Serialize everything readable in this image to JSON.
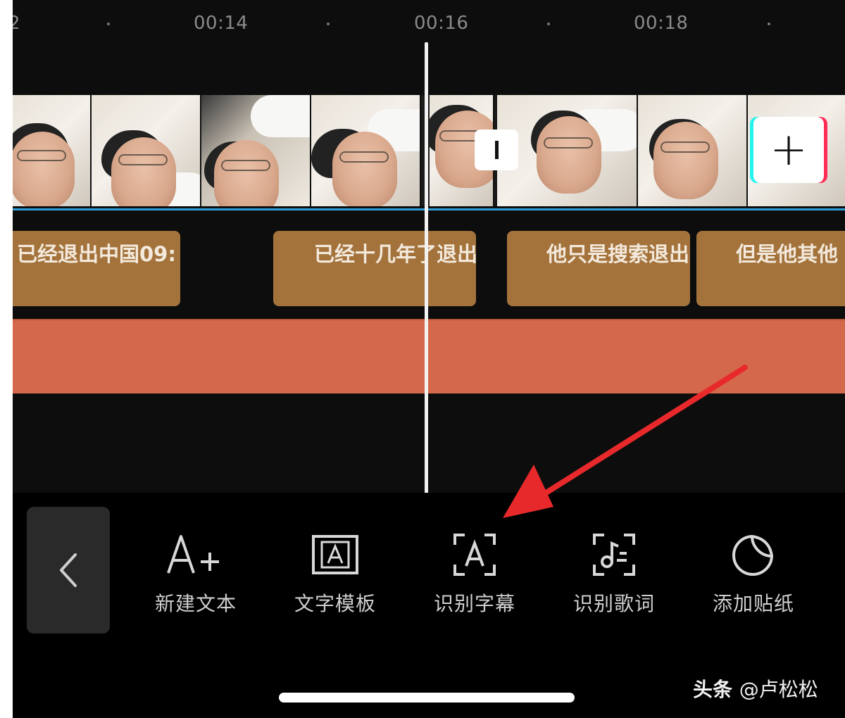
{
  "ruler": {
    "edge_label": "2",
    "labels": [
      "00:14",
      "00:16",
      "00:18"
    ]
  },
  "transition_icon": "transition-bar-icon",
  "add_clip_icon": "plus-icon",
  "subtitles": [
    "已经退出中国09:",
    "已经十几年了退出",
    "他只是搜索退出",
    "但是他其他"
  ],
  "toolbar": {
    "back_icon": "chevron-left-icon",
    "tools": [
      {
        "icon": "text-add-icon",
        "label": "新建文本"
      },
      {
        "icon": "text-template-icon",
        "label": "文字模板"
      },
      {
        "icon": "recognize-subtitle-icon",
        "label": "识别字幕"
      },
      {
        "icon": "recognize-lyrics-icon",
        "label": "识别歌词"
      },
      {
        "icon": "sticker-icon",
        "label": "添加贴纸"
      }
    ]
  },
  "watermark": {
    "brand": "头条",
    "handle": "@卢松松"
  },
  "colors": {
    "subtitle_clip": "#a4733c",
    "audio_track": "#d4684a",
    "strip_underline": "#2f9fd8",
    "arrow": "#e8292b"
  }
}
